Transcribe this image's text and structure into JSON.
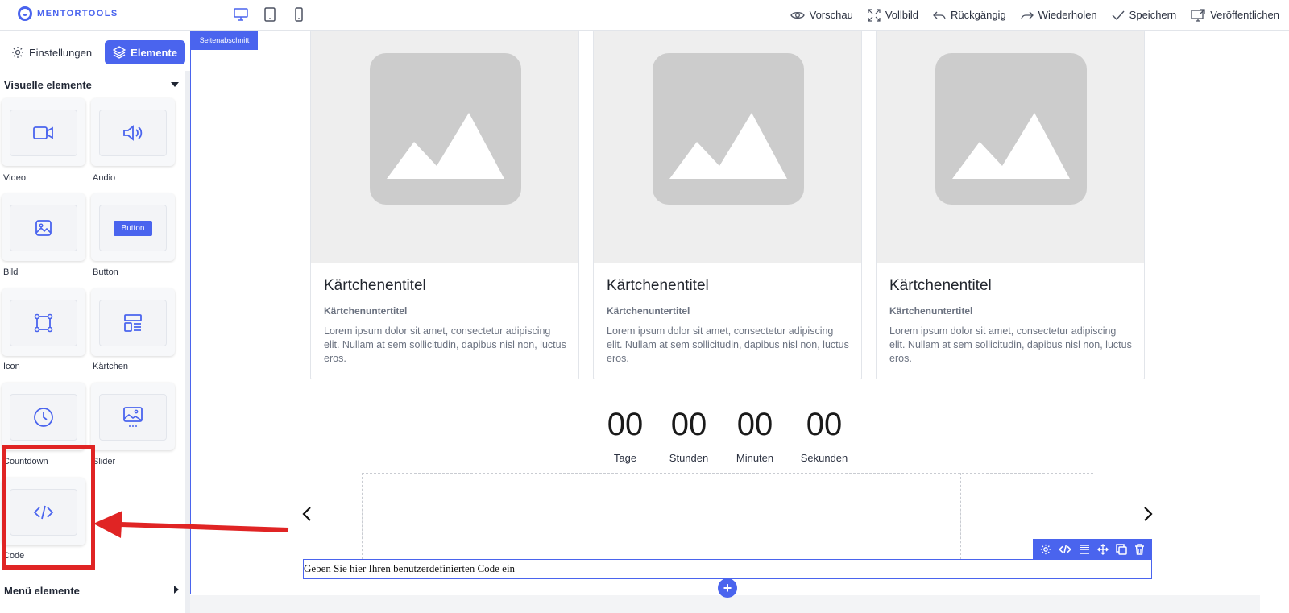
{
  "app": {
    "logo_text": "MENTORTOOLS"
  },
  "topbar": {
    "devices": [
      "desktop-icon",
      "tablet-icon",
      "mobile-icon"
    ],
    "actions": {
      "preview": "Vorschau",
      "fullscreen": "Vollbild",
      "undo": "Rückgängig",
      "redo": "Wiederholen",
      "save": "Speichern",
      "publish": "Veröffentlichen"
    }
  },
  "sidebar": {
    "tabs": {
      "settings": "Einstellungen",
      "elements": "Elemente"
    },
    "visual_section_title": "Visuelle elemente",
    "menu_section_title": "Menü elemente",
    "elements": [
      {
        "label": "Video",
        "icon": "video-icon"
      },
      {
        "label": "Audio",
        "icon": "speaker-icon"
      },
      {
        "label": "Bild",
        "icon": "image-icon"
      },
      {
        "label": "Button",
        "icon": "button-preview",
        "preview_text": "Button"
      },
      {
        "label": "Icon",
        "icon": "vector-square-icon"
      },
      {
        "label": "Kärtchen",
        "icon": "card-layout-icon"
      },
      {
        "label": "Countdown",
        "icon": "clock-icon"
      },
      {
        "label": "Slider",
        "icon": "slider-image-icon"
      },
      {
        "label": "Code",
        "icon": "code-icon"
      }
    ]
  },
  "canvas": {
    "section_badge": "Seitenabschnitt",
    "cards": [
      {
        "title": "Kärtchenentitel",
        "subtitle": "Kärtchenuntertitel",
        "body": "Lorem ipsum dolor sit amet, consectetur adipiscing elit. Nullam at sem sollicitudin, dapibus nisl non, luctus eros."
      },
      {
        "title": "Kärtchenentitel",
        "subtitle": "Kärtchenuntertitel",
        "body": "Lorem ipsum dolor sit amet, consectetur adipiscing elit. Nullam at sem sollicitudin, dapibus nisl non, luctus eros."
      },
      {
        "title": "Kärtchenentitel",
        "subtitle": "Kärtchenuntertitel",
        "body": "Lorem ipsum dolor sit amet, consectetur adipiscing elit. Nullam at sem sollicitudin, dapibus nisl non, luctus eros."
      }
    ],
    "countdown": [
      {
        "value": "00",
        "label": "Tage"
      },
      {
        "value": "00",
        "label": "Stunden"
      },
      {
        "value": "00",
        "label": "Minuten"
      },
      {
        "value": "00",
        "label": "Sekunden"
      }
    ],
    "code_placeholder": "Geben Sie hier Ihren benutzerdefinierten Code ein",
    "code_toolbar": [
      "gear-icon",
      "code-icon",
      "align-icon",
      "move-icon",
      "copy-icon",
      "trash-icon"
    ],
    "add_button": "+"
  },
  "colors": {
    "accent": "#4a64ee",
    "callout": "#e02424",
    "placeholder": "#cccccc"
  }
}
